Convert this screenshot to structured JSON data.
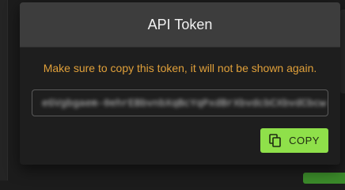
{
  "dialog": {
    "title": "API Token",
    "warning": "Make sure to copy this token, it will not be shown again.",
    "token_value": "eGVgbgaem-0ehrEBbvnbXqBcYqPxdBrXbvdcbCXbvdCbcw",
    "copy_button": {
      "label": "COPY",
      "icon": "copy-icon"
    }
  },
  "colors": {
    "warning_text": "#e0a03a",
    "copy_button_bg": "#8fe04a",
    "header_bg": "#3d3d3d",
    "dialog_bg": "#1e1e1e"
  }
}
